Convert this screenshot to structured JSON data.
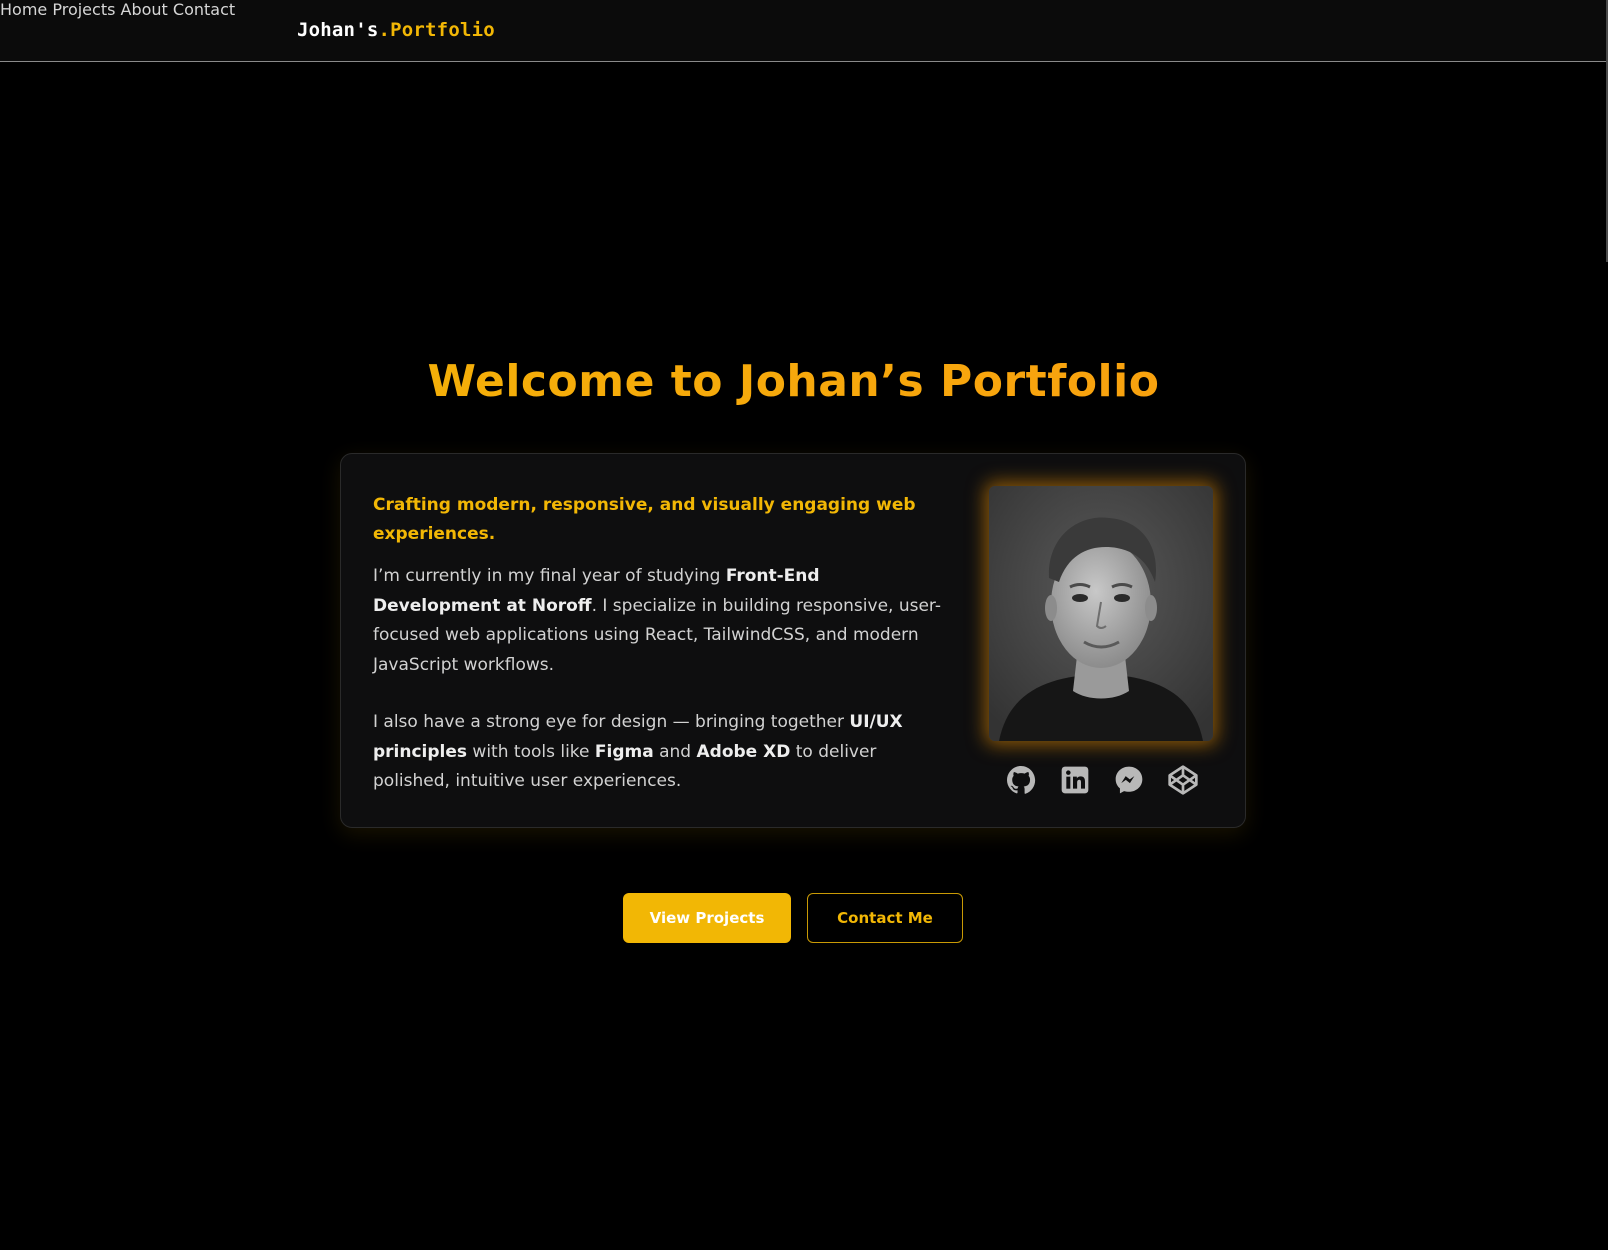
{
  "brand": {
    "part1": "Johan's",
    "part2": ".Portfolio"
  },
  "nav": {
    "items": [
      "Home",
      "Projects",
      "About",
      "Contact"
    ]
  },
  "hero": {
    "title": "Welcome to Johan’s Portfolio",
    "tagline": "Crafting modern, responsive, and visually engaging web experiences.",
    "p1": {
      "t1": "I’m currently in my final year of studying ",
      "b1": "Front-End Development at Noroff",
      "t2": ". I specialize in building responsive, user-focused web applications using React, TailwindCSS, and modern JavaScript workflows."
    },
    "p2": {
      "t1": "I also have a strong eye for design — bringing together ",
      "b1": "UI/UX principles",
      "t2": " with tools like ",
      "b2": "Figma",
      "t3": " and ",
      "b3": "Adobe XD",
      "t4": " to deliver polished, intuitive user experiences."
    },
    "photo_alt": "Portrait of Johan",
    "socials": [
      "github-icon",
      "linkedin-icon",
      "messenger-icon",
      "codepen-icon"
    ]
  },
  "buttons": {
    "primary": "View Projects",
    "secondary": "Contact Me"
  },
  "colors": {
    "accent": "#f2b705",
    "accent_orange": "#fb9a12",
    "background": "#000000",
    "card": "#0e0e0f",
    "icon": "#b8b8b8"
  }
}
